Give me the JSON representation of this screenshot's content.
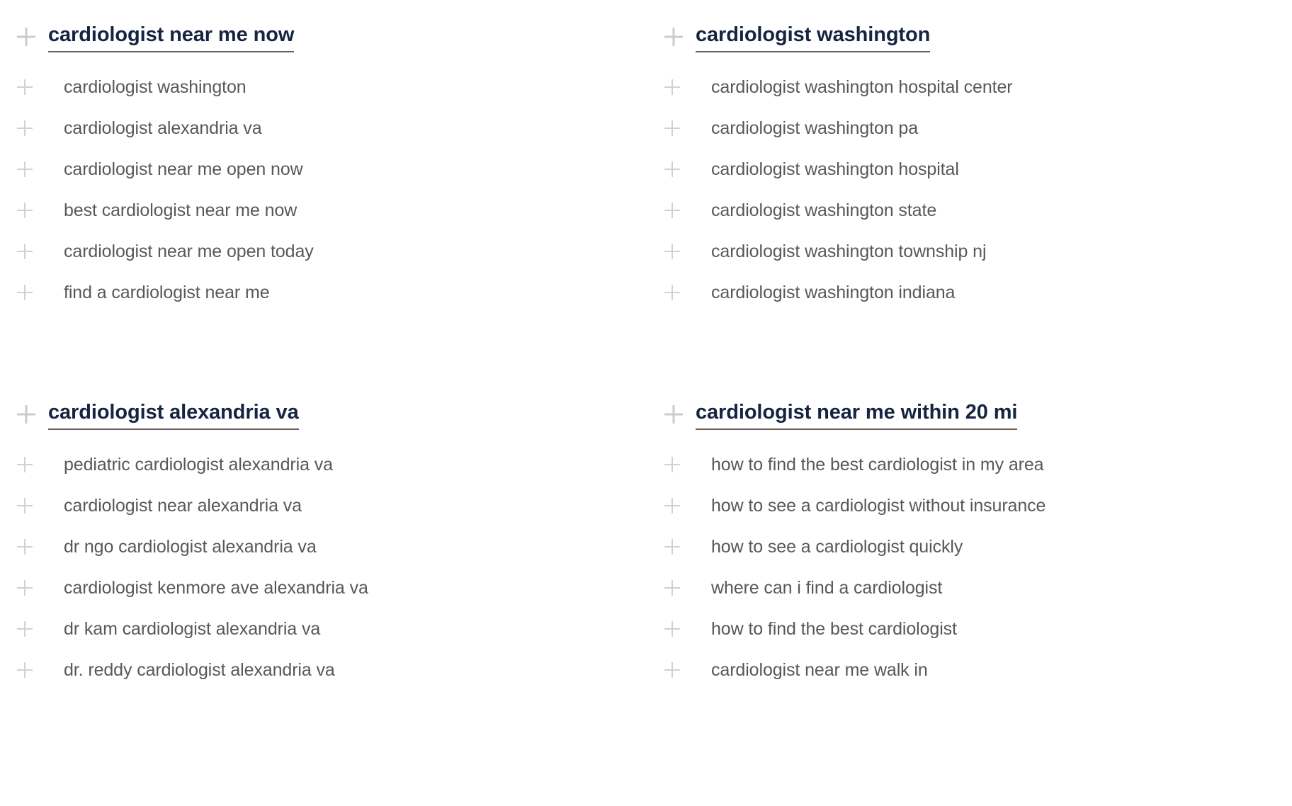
{
  "page": {
    "background_color": "#ffffff",
    "seed_text_color": "#152440",
    "seed_underline_color": "#6d5c57",
    "child_text_color": "#56585a",
    "plus_icon_color": "#c9cccf",
    "expand_icon": "plus-icon"
  },
  "groups": [
    {
      "position": "top-left",
      "seed": "cardiologist near me now",
      "children": [
        "cardiologist washington",
        "cardiologist alexandria va",
        "cardiologist near me open now",
        "best cardiologist near me now",
        "cardiologist near me open today",
        "find a cardiologist near me"
      ]
    },
    {
      "position": "top-right",
      "seed": "cardiologist washington",
      "children": [
        "cardiologist washington hospital center",
        "cardiologist washington pa",
        "cardiologist washington hospital",
        "cardiologist washington state",
        "cardiologist washington township nj",
        "cardiologist washington indiana"
      ]
    },
    {
      "position": "bottom-left",
      "seed": "cardiologist alexandria va",
      "children": [
        "pediatric cardiologist alexandria va",
        "cardiologist near alexandria va",
        "dr ngo cardiologist alexandria va",
        "cardiologist kenmore ave alexandria va",
        "dr kam cardiologist alexandria va",
        "dr. reddy cardiologist alexandria va"
      ]
    },
    {
      "position": "bottom-right",
      "seed": "cardiologist near me within 20 mi",
      "children": [
        "how to find the best cardiologist in my area",
        "how to see a cardiologist without insurance",
        "how to see a cardiologist quickly",
        "where can i find a cardiologist",
        "how to find the best cardiologist",
        "cardiologist near me walk in"
      ]
    }
  ]
}
